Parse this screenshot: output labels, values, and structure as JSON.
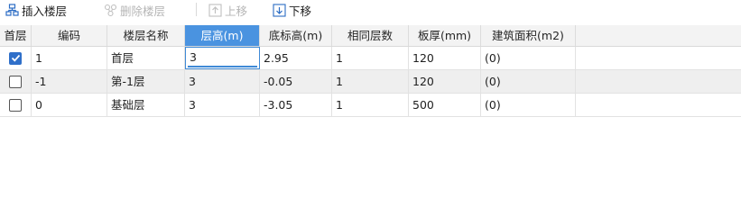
{
  "toolbar": {
    "insert_label": "插入楼层",
    "delete_label": "删除楼层",
    "up_label": "上移",
    "down_label": "下移"
  },
  "columns": [
    "首层",
    "编码",
    "楼层名称",
    "层高(m)",
    "底标高(m)",
    "相同层数",
    "板厚(mm)",
    "建筑面积(m2)"
  ],
  "active_column": "层高(m)",
  "rows": [
    {
      "is_first": true,
      "code": "1",
      "name": "首层",
      "height": "3",
      "base_elevation": "2.95",
      "same_count": "1",
      "slab_thickness": "120",
      "area": "(0)"
    },
    {
      "is_first": false,
      "code": "-1",
      "name": "第-1层",
      "height": "3",
      "base_elevation": "-0.05",
      "same_count": "1",
      "slab_thickness": "120",
      "area": "(0)"
    },
    {
      "is_first": false,
      "code": "0",
      "name": "基础层",
      "height": "3",
      "base_elevation": "-3.05",
      "same_count": "1",
      "slab_thickness": "500",
      "area": "(0)"
    }
  ],
  "colors": {
    "accent": "#4a93e0",
    "check": "#2f6fc9",
    "disabled_text": "#b5b5b5"
  }
}
